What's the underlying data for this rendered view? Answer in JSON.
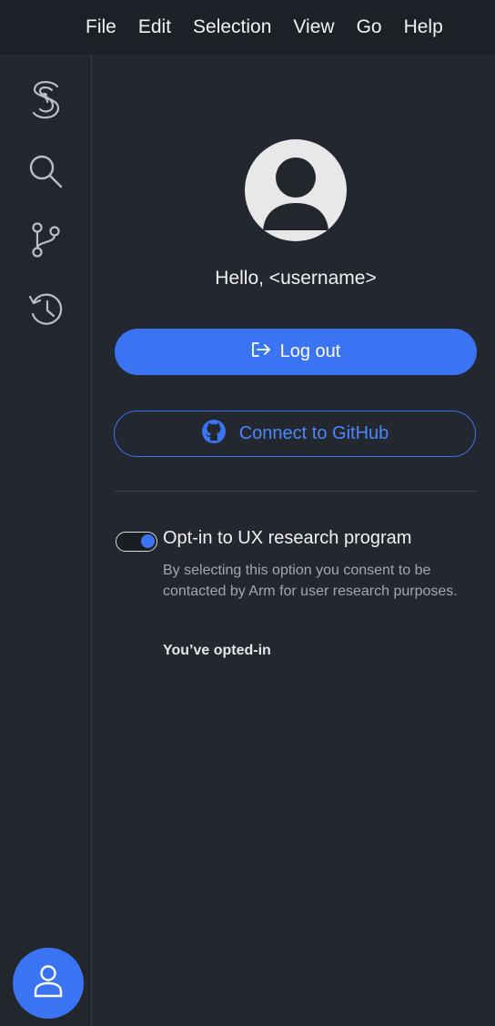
{
  "menu": {
    "items": [
      "File",
      "Edit",
      "Selection",
      "View",
      "Go",
      "Help"
    ]
  },
  "activity_bar": {
    "icons": [
      "logo-s-icon",
      "search-icon",
      "source-control-icon",
      "history-icon"
    ],
    "account_icon": "account-icon"
  },
  "profile": {
    "greeting": "Hello, <username>",
    "avatar_icon": "user-avatar-icon"
  },
  "actions": {
    "logout_label": "Log out",
    "logout_icon": "log-out-icon",
    "github_label": "Connect to GitHub",
    "github_icon": "github-icon"
  },
  "research": {
    "toggle_on": true,
    "label": "Opt-in to UX research program",
    "description": "By selecting this option you consent to be contacted by Arm for user research purposes.",
    "status": "You’ve opted-in"
  },
  "colors": {
    "accent": "#3b74f2",
    "background": "#232830",
    "menubar": "#1c2127"
  }
}
